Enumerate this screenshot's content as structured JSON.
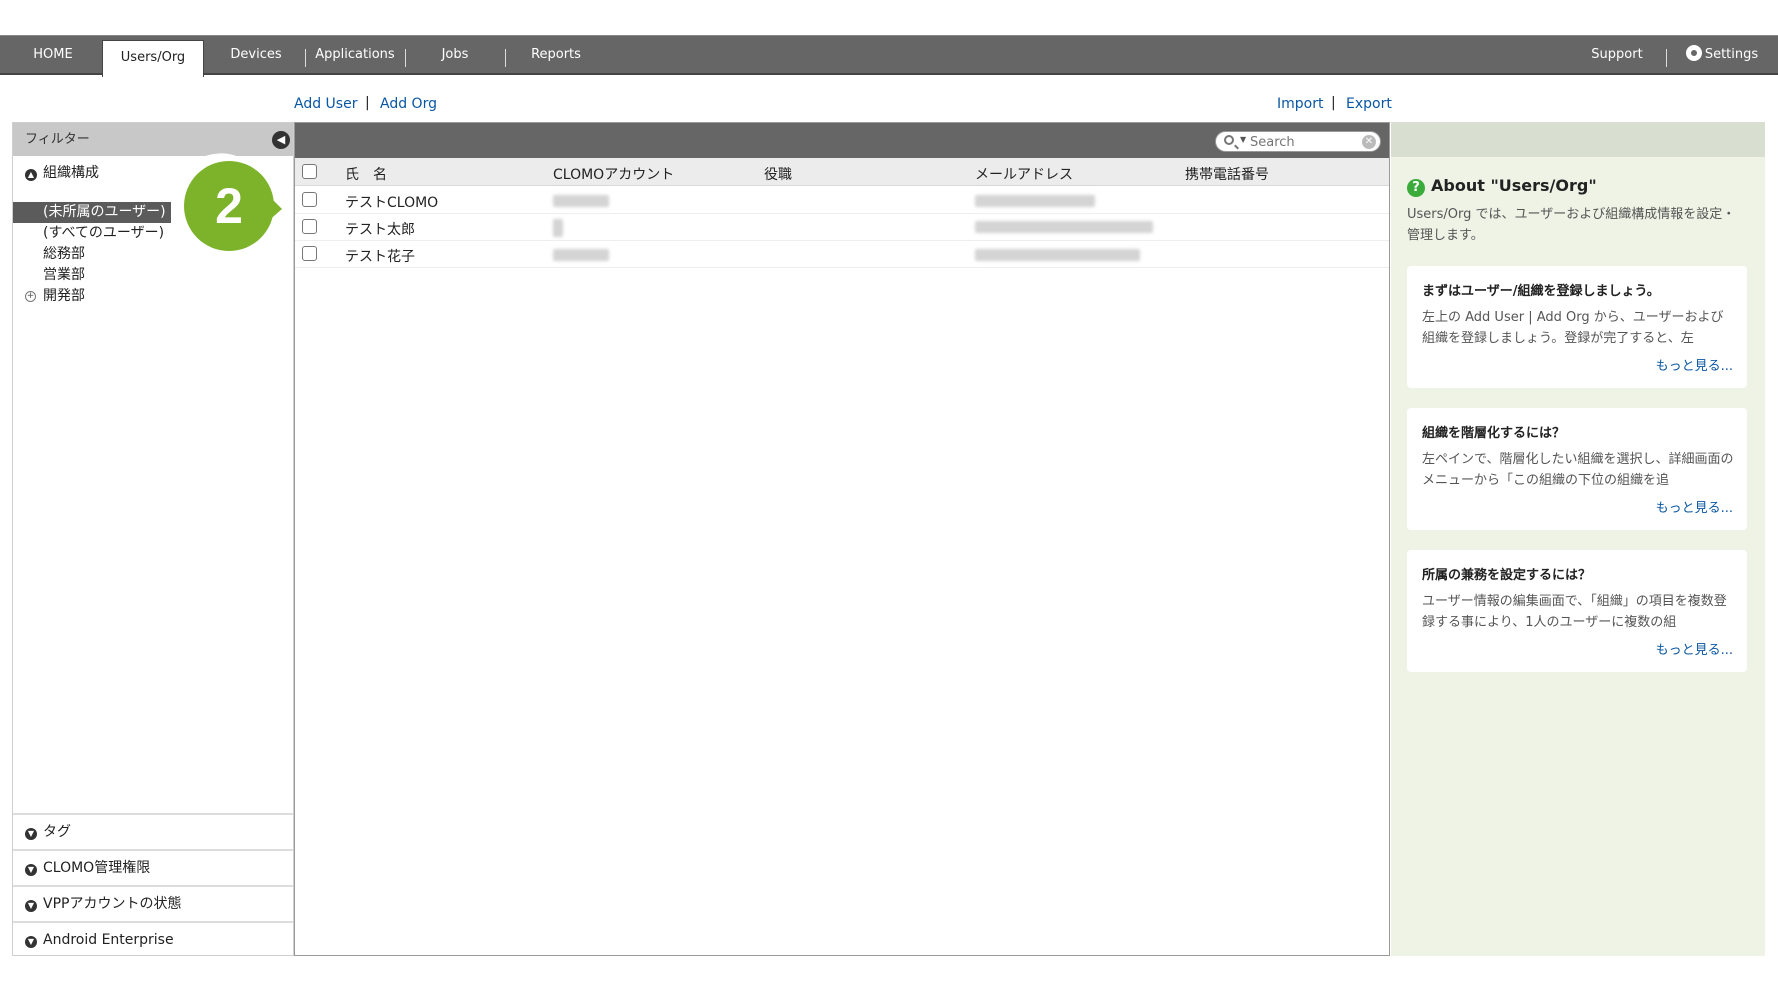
{
  "nav": {
    "items": [
      "HOME",
      "Users/Org",
      "Devices",
      "Applications",
      "Jobs",
      "Reports"
    ],
    "active": "Users/Org",
    "support": "Support",
    "settings": "Settings"
  },
  "actions": {
    "add_user": "Add User",
    "add_org": "Add Org",
    "import": "Import",
    "export": "Export",
    "separator": "|"
  },
  "filter": {
    "title": "フィルター",
    "org_section": "組織構成",
    "org_items": [
      {
        "label": "(未所属のユーザー)",
        "selected": true
      },
      {
        "label": "(すべてのユーザー)",
        "selected": false
      },
      {
        "label": "総務部",
        "selected": false
      },
      {
        "label": "営業部",
        "selected": false
      },
      {
        "label": "開発部",
        "selected": false,
        "expandable": true
      }
    ],
    "bottom_sections": [
      "タグ",
      "CLOMO管理権限",
      "VPPアカウントの状態",
      "Android Enterprise"
    ]
  },
  "search": {
    "placeholder": "Search"
  },
  "table": {
    "columns": [
      "氏　名",
      "CLOMOアカウント",
      "役職",
      "メールアドレス",
      "携帯電話番号"
    ],
    "rows": [
      {
        "name": "テストCLOMO"
      },
      {
        "name": "テスト太郎"
      },
      {
        "name": "テスト花子"
      }
    ]
  },
  "callout": {
    "number": "2",
    "color": "#7cb32a"
  },
  "info": {
    "title": "About \"Users/Org\"",
    "description": "Users/Org では、ユーザーおよび組織構成情報を設定・管理します。",
    "cards": [
      {
        "title": "まずはユーザー/組織を登録しましょう。",
        "body": "左上の Add User | Add Org から、ユーザーおよび組織を登録しましょう。登録が完了すると、左",
        "more": "もっと見る..."
      },
      {
        "title": "組織を階層化するには？",
        "body": "左ペインで、階層化したい組織を選択し、詳細画面のメニューから「この組織の下位の組織を追",
        "more": "もっと見る..."
      },
      {
        "title": "所属の兼務を設定するには？",
        "body": "ユーザー情報の編集画面で、「組織」の項目を複数登録する事により、1人のユーザーに複数の組",
        "more": "もっと見る..."
      }
    ]
  },
  "colors": {
    "nav_bg": "#666666",
    "link": "#0a57a3",
    "info_bg": "#eef3e6",
    "help_icon": "#3bab3b"
  }
}
